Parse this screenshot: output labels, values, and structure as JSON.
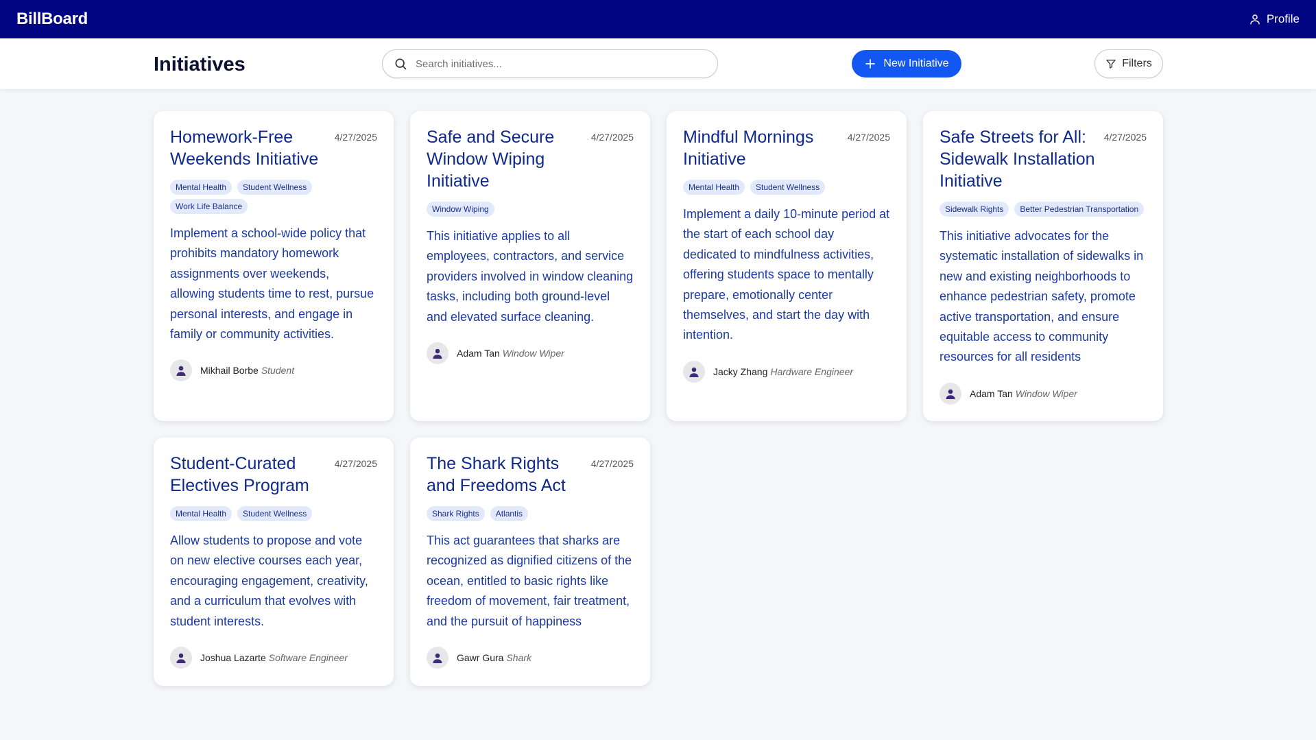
{
  "app": {
    "brand": "BillBoard",
    "profile_label": "Profile"
  },
  "header": {
    "title": "Initiatives",
    "search_placeholder": "Search initiatives...",
    "new_button_label": "New Initiative",
    "filters_label": "Filters"
  },
  "colors": {
    "topbar": "#010582",
    "primary": "#1357f2",
    "title_text": "#0f2a8a",
    "body_text": "#1c3aa6",
    "tag_bg": "#e2e9fb"
  },
  "icons": {
    "profile": "user-icon",
    "search": "search-icon",
    "new": "plus-icon",
    "filters": "filter-icon",
    "avatar": "person-icon"
  },
  "initiatives": [
    {
      "title": "Homework-Free Weekends Initiative",
      "date": "4/27/2025",
      "tags": [
        "Mental Health",
        "Student Wellness",
        "Work Life Balance"
      ],
      "description": "Implement a school-wide policy that prohibits mandatory homework assignments over weekends, allowing students time to rest, pursue personal interests, and engage in family or community activities.",
      "author": "Mikhail Borbe",
      "role": "Student"
    },
    {
      "title": "Safe and Secure Window Wiping Initiative",
      "date": "4/27/2025",
      "tags": [
        "Window Wiping"
      ],
      "description": "This initiative applies to all employees, contractors, and service providers involved in window cleaning tasks, including both ground-level and elevated surface cleaning.",
      "author": "Adam Tan",
      "role": "Window Wiper"
    },
    {
      "title": "Mindful Mornings Initiative",
      "date": "4/27/2025",
      "tags": [
        "Mental Health",
        "Student Wellness"
      ],
      "description": "Implement a daily 10-minute period at the start of each school day dedicated to mindfulness activities, offering students space to mentally prepare, emotionally center themselves, and start the day with intention.",
      "author": "Jacky Zhang",
      "role": "Hardware Engineer"
    },
    {
      "title": "Safe Streets for All: Sidewalk Installation Initiative",
      "date": "4/27/2025",
      "tags": [
        "Sidewalk Rights",
        "Better Pedestrian Transportation"
      ],
      "description": "This initiative advocates for the systematic installation of sidewalks in new and existing neighborhoods to enhance pedestrian safety, promote active transportation, and ensure equitable access to community resources for all residents",
      "author": "Adam Tan",
      "role": "Window Wiper"
    },
    {
      "title": "Student-Curated Electives Program",
      "date": "4/27/2025",
      "tags": [
        "Mental Health",
        "Student Wellness"
      ],
      "description": "Allow students to propose and vote on new elective courses each year, encouraging engagement, creativity, and a curriculum that evolves with student interests.",
      "author": "Joshua Lazarte",
      "role": "Software Engineer"
    },
    {
      "title": "The Shark Rights and Freedoms Act",
      "date": "4/27/2025",
      "tags": [
        "Shark Rights",
        "Atlantis"
      ],
      "description": "This act guarantees that sharks are recognized as dignified citizens of the ocean, entitled to basic rights like freedom of movement, fair treatment, and the pursuit of happiness",
      "author": "Gawr Gura",
      "role": "Shark"
    }
  ]
}
